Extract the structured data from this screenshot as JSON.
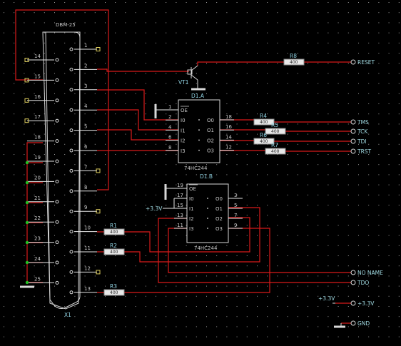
{
  "colors": {
    "background": "#000000",
    "wire": "#d81a1a",
    "component": "#d8d8d8",
    "junction": "#22c022",
    "text": "#c8c8c8",
    "net_label": "#9fd8e0"
  },
  "connector": {
    "name": "DBM-25",
    "ref": "X1",
    "top_pins": [
      "1",
      "2",
      "3",
      "4",
      "5",
      "6",
      "7",
      "8",
      "9",
      "10",
      "11",
      "12",
      "13"
    ],
    "bottom_pins": [
      "14",
      "15",
      "16",
      "17",
      "18",
      "19",
      "20",
      "21",
      "22",
      "23",
      "24",
      "25"
    ]
  },
  "transistor": {
    "ref": "VT1"
  },
  "chip_a": {
    "ref": "D1.A",
    "part": "74HC244",
    "oe": "OE",
    "left_pins": [
      "1",
      "2",
      "4",
      "6",
      "8"
    ],
    "left_names": [
      "OE",
      "I0",
      "I1",
      "I2",
      "I3"
    ],
    "right_pins": [
      "18",
      "16",
      "14",
      "12"
    ],
    "right_names": [
      "O0",
      "O1",
      "O2",
      "O3"
    ]
  },
  "chip_b": {
    "ref": "D1.B",
    "part": "74HC244",
    "oe": "OE",
    "left_pins": [
      "19",
      "17",
      "15",
      "13",
      "11"
    ],
    "left_names": [
      "OE",
      "I0",
      "I1",
      "I2",
      "I3"
    ],
    "right_pins": [
      "3",
      "5",
      "7",
      "9"
    ],
    "right_names": [
      "O0",
      "O1",
      "O2",
      "O3"
    ],
    "supply_label": "+3.3V"
  },
  "resistors": [
    {
      "ref": "R8",
      "value": "400"
    },
    {
      "ref": "R4",
      "value": "400"
    },
    {
      "ref": "R5",
      "value": "400"
    },
    {
      "ref": "R6",
      "value": "400"
    },
    {
      "ref": "R7",
      "value": "400"
    },
    {
      "ref": "R1",
      "value": "400"
    },
    {
      "ref": "R2",
      "value": "400"
    },
    {
      "ref": "R3",
      "value": "400"
    }
  ],
  "nets": {
    "reset": "RESET",
    "tms": "TMS",
    "tck": "TCK",
    "tdi": "TDI",
    "trst": "TRST",
    "no_name": "NO NAME",
    "tdo": "TDO",
    "supply_in": "+3.3V",
    "supply_out": "+3.3V",
    "gnd": "GND"
  }
}
